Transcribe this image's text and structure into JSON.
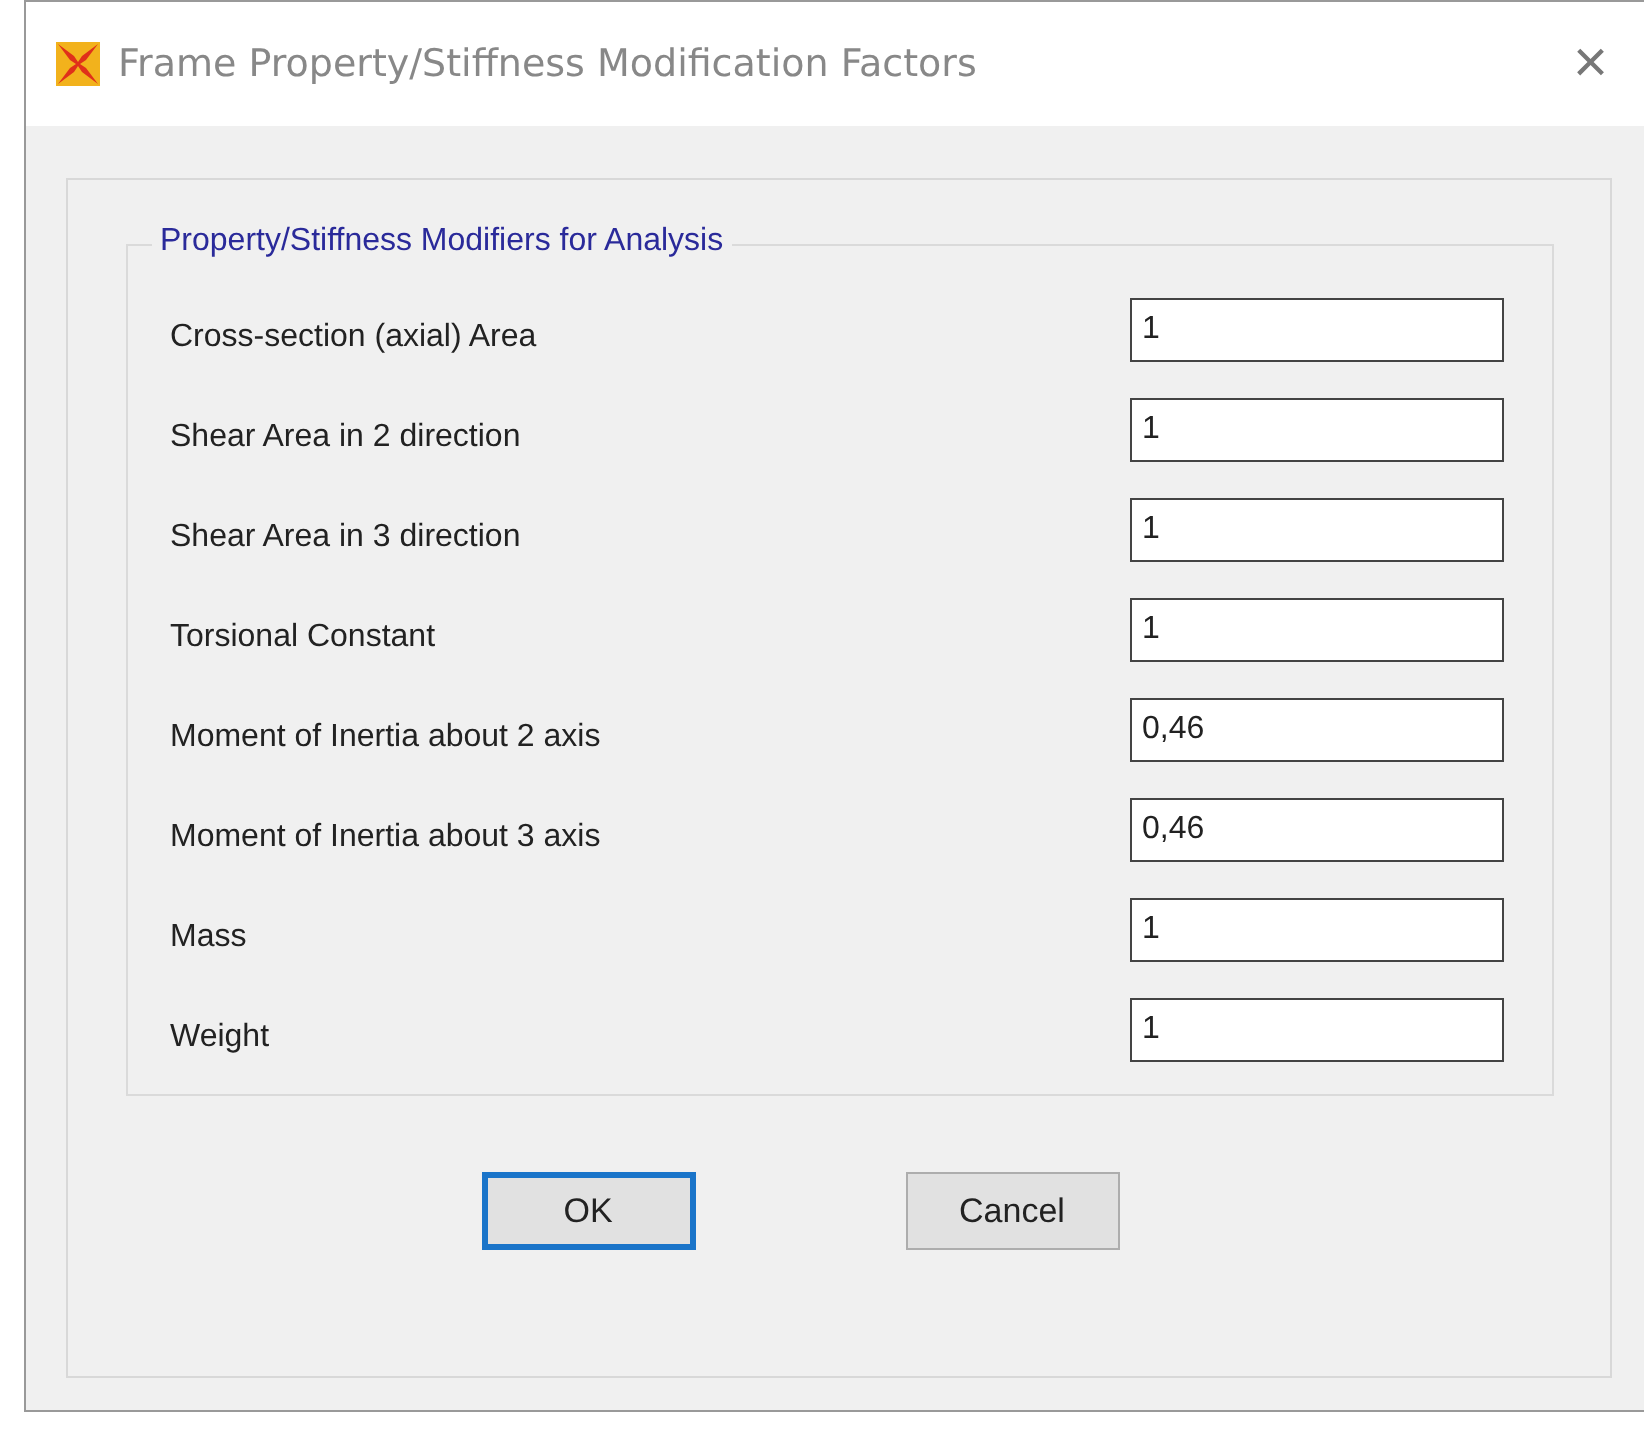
{
  "window": {
    "title": "Frame Property/Stiffness Modification Factors",
    "close": "×"
  },
  "group": {
    "title": "Property/Stiffness Modifiers for Analysis",
    "rows": [
      {
        "label": "Cross-section (axial) Area",
        "value": "1"
      },
      {
        "label": "Shear Area in 2 direction",
        "value": "1"
      },
      {
        "label": "Shear Area in 3 direction",
        "value": "1"
      },
      {
        "label": "Torsional Constant",
        "value": "1"
      },
      {
        "label": "Moment of Inertia about 2 axis",
        "value": "0,46"
      },
      {
        "label": "Moment of Inertia about 3 axis",
        "value": "0,46"
      },
      {
        "label": "Mass",
        "value": "1"
      },
      {
        "label": "Weight",
        "value": "1"
      }
    ]
  },
  "buttons": [
    {
      "label": "OK",
      "default": true
    },
    {
      "label": "Cancel",
      "default": false
    }
  ]
}
